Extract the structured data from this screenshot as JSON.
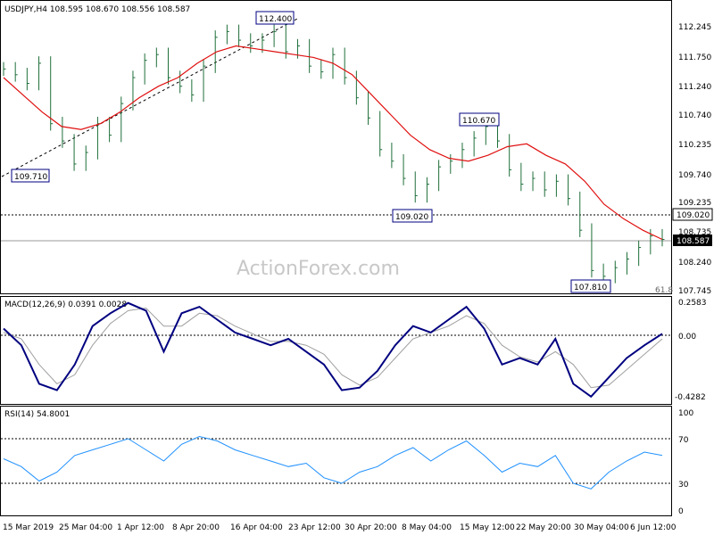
{
  "header": "USDJPY,H4  108.595 108.670 108.556 108.587",
  "watermark": "ActionForex.com",
  "colors": {
    "bars": "#1f6f3a",
    "ma": "#e01010",
    "macd": "#000080",
    "signal": "#a0a0a0",
    "rsi": "#1e90ff",
    "last_tag": "#000000",
    "level_tag": "#000000"
  },
  "chart_data": [
    {
      "type": "line",
      "title": "USDJPY,H4  108.595 108.670 108.556 108.587",
      "price_ticks": [
        "112.245",
        "111.750",
        "111.240",
        "110.740",
        "110.235",
        "109.740",
        "109.235",
        "108.735",
        "108.240",
        "107.745"
      ],
      "ylim": [
        107.7,
        112.5
      ],
      "x_labels": [
        "15 Mar 2019",
        "25 Mar 04:00",
        "1 Apr 12:00",
        "8 Apr 20:00",
        "16 Apr 04:00",
        "23 Apr 12:00",
        "30 Apr 20:00",
        "8 May 04:00",
        "15 May 12:00",
        "22 May 20:00",
        "30 May 04:00",
        "6 Jun 12:00"
      ],
      "series": [
        {
          "values": [
            111.55,
            111.45,
            111.3,
            111.65,
            110.6,
            110.3,
            109.9,
            110.1,
            110.6,
            110.4,
            110.95,
            111.4,
            111.7,
            111.8,
            111.4,
            111.25,
            111.1,
            111.6,
            112.1,
            112.2,
            112.05,
            111.95,
            112.05,
            112.2,
            111.85,
            111.95,
            111.6,
            111.5,
            111.8,
            111.4,
            111.05,
            110.7,
            110.15,
            109.95,
            109.65,
            109.35,
            109.55,
            109.85,
            109.95,
            110.15,
            110.35,
            110.55,
            110.3,
            109.8,
            109.55,
            109.65,
            109.45,
            109.6,
            109.3,
            108.75,
            108.05,
            107.95,
            108.1,
            108.25,
            108.45,
            108.65,
            108.59
          ]
        },
        {
          "values": [
            111.4,
            111.1,
            110.8,
            110.55,
            110.5,
            110.6,
            110.8,
            111.05,
            111.25,
            111.4,
            111.65,
            111.85,
            111.95,
            111.9,
            111.85,
            111.8,
            111.75,
            111.65,
            111.45,
            111.1,
            110.75,
            110.4,
            110.15,
            110.0,
            109.95,
            110.05,
            110.2,
            110.25,
            110.05,
            109.9,
            109.6,
            109.2,
            108.95,
            108.75,
            108.59
          ]
        }
      ],
      "annotations": [
        "112.400",
        "109.710",
        "109.020",
        "110.670",
        "107.810",
        "61.8"
      ],
      "level_tags": [
        "109.020",
        "108.587"
      ]
    },
    {
      "type": "line",
      "title": "MACD(12,26,9) 0.0391 0.0028",
      "ticks": [
        "0.2583",
        "0.00",
        "-0.4282"
      ],
      "ylim": [
        -0.5,
        0.32
      ],
      "series": [
        {
          "values": [
            0.08,
            -0.05,
            -0.35,
            -0.4,
            -0.2,
            0.1,
            0.2,
            0.28,
            0.22,
            -0.1,
            0.2,
            0.25,
            0.15,
            0.05,
            0.0,
            -0.05,
            0.0,
            -0.1,
            -0.2,
            -0.4,
            -0.38,
            -0.25,
            -0.05,
            0.1,
            0.05,
            0.15,
            0.25,
            0.08,
            -0.2,
            -0.15,
            -0.2,
            0.0,
            -0.35,
            -0.45,
            -0.3,
            -0.15,
            -0.05,
            0.04
          ]
        },
        {
          "values": [
            0.05,
            0.0,
            -0.2,
            -0.35,
            -0.28,
            -0.05,
            0.12,
            0.22,
            0.24,
            0.1,
            0.1,
            0.2,
            0.18,
            0.1,
            0.04,
            -0.02,
            -0.02,
            -0.05,
            -0.12,
            -0.28,
            -0.36,
            -0.3,
            -0.15,
            0.0,
            0.05,
            0.1,
            0.18,
            0.12,
            -0.05,
            -0.14,
            -0.18,
            -0.1,
            -0.2,
            -0.38,
            -0.36,
            -0.24,
            -0.12,
            0.0
          ]
        }
      ]
    },
    {
      "type": "line",
      "title": "RSI(14) 54.8001",
      "ticks": [
        "100",
        "70",
        "30",
        "0"
      ],
      "ylim": [
        0,
        100
      ],
      "series": [
        {
          "values": [
            52,
            45,
            32,
            40,
            55,
            60,
            65,
            70,
            60,
            50,
            65,
            72,
            68,
            60,
            55,
            50,
            45,
            48,
            35,
            30,
            40,
            45,
            55,
            62,
            50,
            60,
            68,
            55,
            40,
            48,
            45,
            55,
            30,
            25,
            40,
            50,
            58,
            55
          ]
        }
      ]
    }
  ]
}
